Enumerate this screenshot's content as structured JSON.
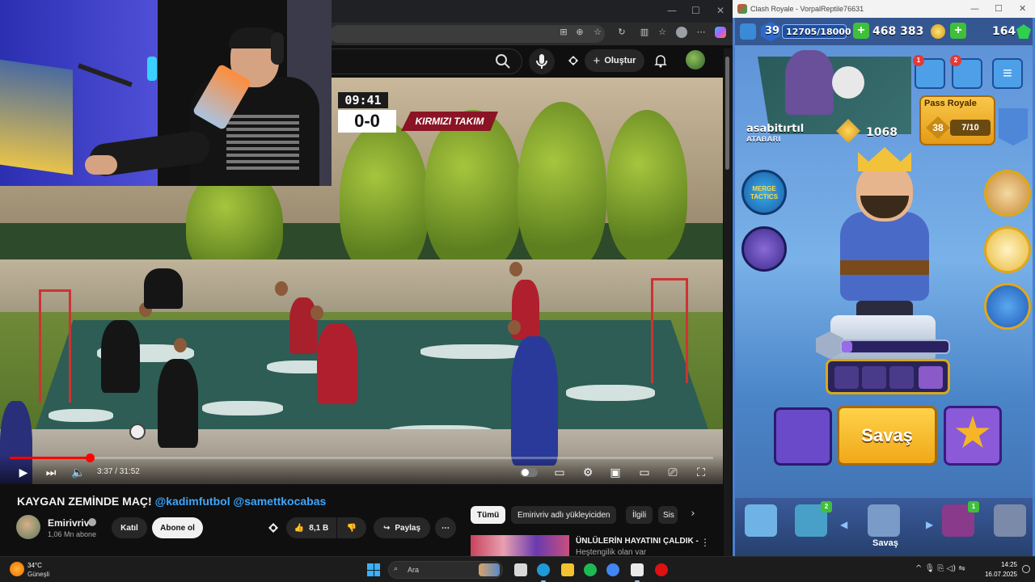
{
  "browser": {
    "controls": {
      "minimize": "—",
      "maximize": "☐",
      "close": "✕"
    }
  },
  "youtube": {
    "create_label": "Oluştur",
    "icons": [
      "search-icon",
      "mic-icon",
      "extension-icon",
      "bell-icon",
      "avatar"
    ],
    "video": {
      "scoreboard_time": "09:41",
      "scoreboard_score": "0-0",
      "scoreboard_team": "KIRMIZI TAKIM",
      "current_time": "3:37",
      "duration": "31:52",
      "time_display": "3:37 / 31:52",
      "progress_fraction": 0.114
    },
    "title_main": "KAYGAN ZEMİNDE MAÇ!",
    "title_tags": " @kadimfutbol @samettkocabas",
    "channel_name": "Emirivriv",
    "subscribers": "1,06 Mn abone",
    "join_label": "Katıl",
    "subscribe_label": "Abone ol",
    "likes": "8,1 B",
    "share_label": "Paylaş",
    "chips": [
      "Tümü",
      "Emirivriv adlı yükleyiciden",
      "İlgili",
      "Sis"
    ],
    "rec_title": "ÜNLÜLERİN HAYATINI ÇALDIK -",
    "rec_subtitle": "Heştengilik olan var"
  },
  "clash": {
    "window_title": "Clash Royale - VorpalReptile76631",
    "level": "39",
    "xp": "12705/18000",
    "gold": "468 383",
    "gems": "164",
    "player_name": "asabitırtıl",
    "clan_name": "ATABARI",
    "trophies": "1068",
    "pass_label": "Pass Royale",
    "pass_level": "38",
    "pass_progress": "7/10",
    "profile_badge": "1",
    "news_badge": "2",
    "merge_tactics": "MERGE TACTICS",
    "battle_label": "Savaş",
    "nav_battle": "Savaş",
    "nav_cards_badge": "2",
    "nav_clan_badge": "1",
    "level_progress_fraction": 0.1
  },
  "taskbar": {
    "temperature": "34°C",
    "weather": "Güneşli",
    "search_label": "Ara",
    "time": "14:25",
    "date": "16.07.2025",
    "tray": "^  🎙  ⎘  ◁)  ⇋"
  }
}
